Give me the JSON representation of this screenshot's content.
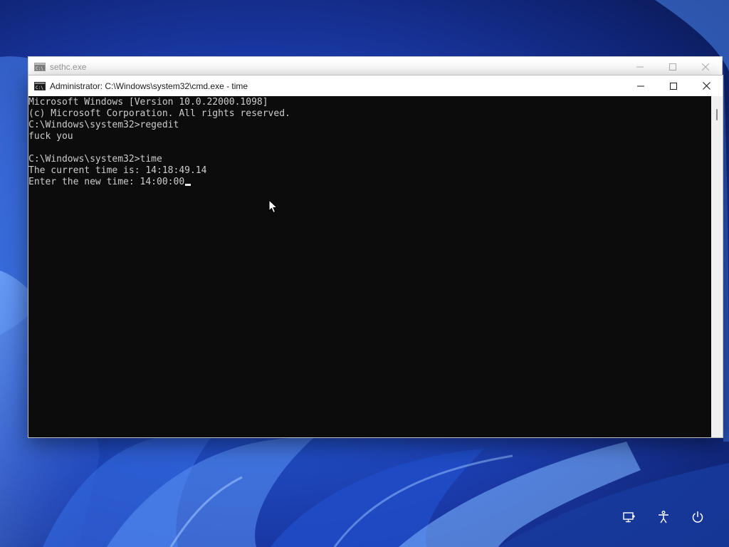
{
  "background_window": {
    "title": "sethc.exe",
    "icon": "cmd-console-icon"
  },
  "console_window": {
    "title": "Administrator: C:\\Windows\\system32\\cmd.exe - time",
    "icon": "cmd-console-icon"
  },
  "console": {
    "lines": [
      "Microsoft Windows [Version 10.0.22000.1098]",
      "(c) Microsoft Corporation. All rights reserved.",
      "C:\\Windows\\system32>regedit",
      "fuck you",
      "",
      "C:\\Windows\\system32>time",
      "The current time is: 14:18:49.14",
      "Enter the new time: 14:00:00"
    ]
  },
  "tray": {
    "network": "network-icon",
    "accessibility": "accessibility-icon",
    "power": "power-icon"
  },
  "colors": {
    "console_bg": "#0c0c0c",
    "console_text": "#cccccc",
    "desktop_accent": "#2150c8"
  }
}
